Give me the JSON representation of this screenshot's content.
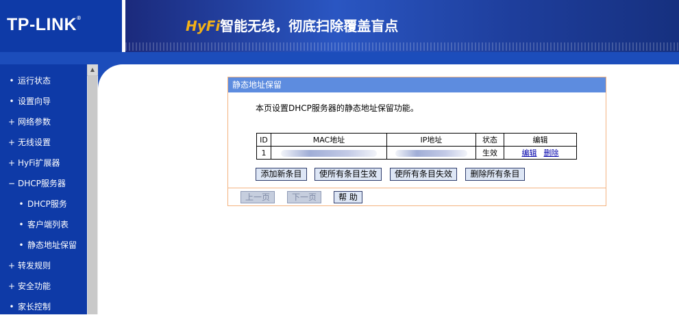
{
  "header": {
    "logo": "TP-LINK",
    "logo_mark": "®",
    "slogan_accent": "HyFi",
    "slogan_text": "智能无线，彻底扫除覆盖盲点"
  },
  "sidebar": {
    "items": [
      {
        "bullet": "•",
        "label": "运行状态"
      },
      {
        "bullet": "•",
        "label": "设置向导"
      },
      {
        "bullet": "+",
        "label": "网络参数"
      },
      {
        "bullet": "+",
        "label": "无线设置"
      },
      {
        "bullet": "+",
        "label": "HyFi扩展器"
      },
      {
        "bullet": "−",
        "label": "DHCP服务器"
      },
      {
        "bullet": "•",
        "label": "DHCP服务"
      },
      {
        "bullet": "•",
        "label": "客户端列表"
      },
      {
        "bullet": "•",
        "label": "静态地址保留"
      },
      {
        "bullet": "+",
        "label": "转发规则"
      },
      {
        "bullet": "+",
        "label": "安全功能"
      },
      {
        "bullet": "•",
        "label": "家长控制"
      }
    ]
  },
  "panel": {
    "title": "静态地址保留",
    "description": "本页设置DHCP服务器的静态地址保留功能。"
  },
  "table": {
    "headers": [
      "ID",
      "MAC地址",
      "IP地址",
      "状态",
      "编辑"
    ],
    "rows": [
      {
        "id": "1",
        "status": "生效",
        "edit": "编辑",
        "delete": "删除"
      }
    ]
  },
  "buttons": {
    "add_new": "添加新条目",
    "enable_all": "使所有条目生效",
    "disable_all": "使所有条目失效",
    "delete_all": "删除所有条目"
  },
  "pager": {
    "prev": "上一页",
    "next": "下一页",
    "help": "帮 助"
  }
}
